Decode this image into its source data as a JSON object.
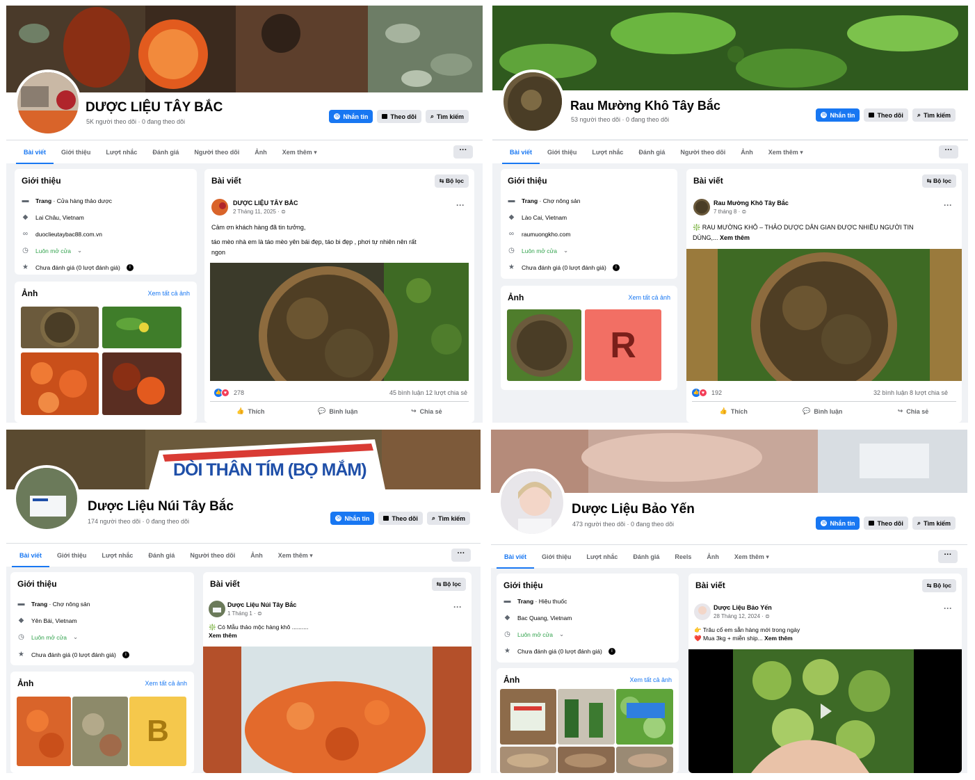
{
  "common": {
    "tabs_default": [
      "Bài viết",
      "Giới thiệu",
      "Lượt nhắc",
      "Đánh giá",
      "Người theo dõi",
      "Ảnh",
      "Xem thêm ▾"
    ],
    "tabs_reels": [
      "Bài viết",
      "Giới thiệu",
      "Lượt nhắc",
      "Đánh giá",
      "Reels",
      "Ảnh",
      "Xem thêm ▾"
    ],
    "message_label": "Nhắn tin",
    "follow_label": "Theo dõi",
    "search_label": "Tìm kiếm",
    "more_label": "···",
    "intro_title": "Giới thiệu",
    "photos_title": "Ảnh",
    "see_all_photos": "Xem tất cả ảnh",
    "posts_title": "Bài viết",
    "filter_label": "Bộ lọc",
    "like_label": "Thích",
    "comment_label": "Bình luận",
    "share_label": "Chia sẻ",
    "post_menu": "···",
    "accent_color": "#1877f2"
  },
  "panels": [
    {
      "page_name": "DƯỢC LIỆU TÂY BẮC",
      "stats": "5K người theo dõi · 0 đang theo dõi",
      "intro": {
        "category_prefix": "Trang",
        "category": " · Cửa hàng thảo dược",
        "location": "Lai Châu, Vietnam",
        "website": "duoclieutaybac88.com.vn",
        "hours": "Luôn mở cửa",
        "rating": "Chưa đánh giá (0 lượt đánh giá)"
      },
      "post": {
        "author": "DƯỢC LIỆU TÂY BẮC",
        "date": "2 Tháng 11, 2025 · ⊜",
        "text_1": "Cảm ơn khách hàng đã tin tưởng,",
        "text_2": "táo mèo nhà em là táo mèo yên bái đẹp, táo bi đẹp , phơi tự nhiên nên rất ngon",
        "reactions": "278",
        "comments_shares": "45 bình luận  12 lượt chia sẻ"
      }
    },
    {
      "page_name": "Rau Mường Khô Tây Bắc",
      "stats": "53 người theo dõi · 0 đang theo dõi",
      "intro": {
        "category_prefix": "Trang",
        "category": " · Chợ nông sản",
        "location": "Lào Cai, Vietnam",
        "website": "raumuongkho.com",
        "hours": "Luôn mở cửa",
        "rating": "Chưa đánh giá (0 lượt đánh giá)"
      },
      "photo_letter": "R",
      "post": {
        "author": "Rau Mường Khô Tây Bắc",
        "date": "7 tháng 8 · ⊜",
        "text_1": "❇️ RAU MƯỜNG KHÔ – THẢO DƯỢC DÂN GIAN ĐƯỢC NHIỀU NGƯỜI TIN DÙNG,...",
        "see_more": "Xem thêm",
        "reactions": "192",
        "comments_shares": "32 bình luận  8 lượt chia sẻ"
      }
    },
    {
      "page_name": "Dược Liệu Núi Tây Bắc",
      "stats": "174 người theo dõi · 0 đang theo dõi",
      "cover_sign": "DÒI THÂN TÍM (BỌ MẮM)",
      "intro": {
        "category_prefix": "Trang",
        "category": " · Chợ nông sản",
        "location": "Yên Bái, Vietnam",
        "hours": "Luôn mở cửa",
        "rating": "Chưa đánh giá (0 lượt đánh giá)"
      },
      "photo_letter": "B",
      "post": {
        "author": "Dược Liệu Núi Tây Bắc",
        "date": "1 Tháng 1 · ⊜",
        "text_1": "❇️ Có Mẫu thảo mộc hàng khô ..........",
        "see_more": "Xem thêm"
      }
    },
    {
      "page_name": "Dược Liệu Bảo Yến",
      "stats": "473 người theo dõi · 0 đang theo dõi",
      "intro": {
        "category_prefix": "Trang",
        "category": " · Hiệu thuốc",
        "location": "Bac Quang, Vietnam",
        "hours": "Luôn mở cửa",
        "rating": "Chưa đánh giá (0 lượt đánh giá)"
      },
      "post": {
        "author": "Dược Liệu Bảo Yến",
        "date": "28 Tháng 12, 2024 · ⊜",
        "text_1": "👉 Trâu cổ em sẵn hàng mới trong ngày",
        "text_2": "❤️ Mua 3kg + miễn ship...",
        "see_more": "Xem thêm"
      }
    }
  ]
}
